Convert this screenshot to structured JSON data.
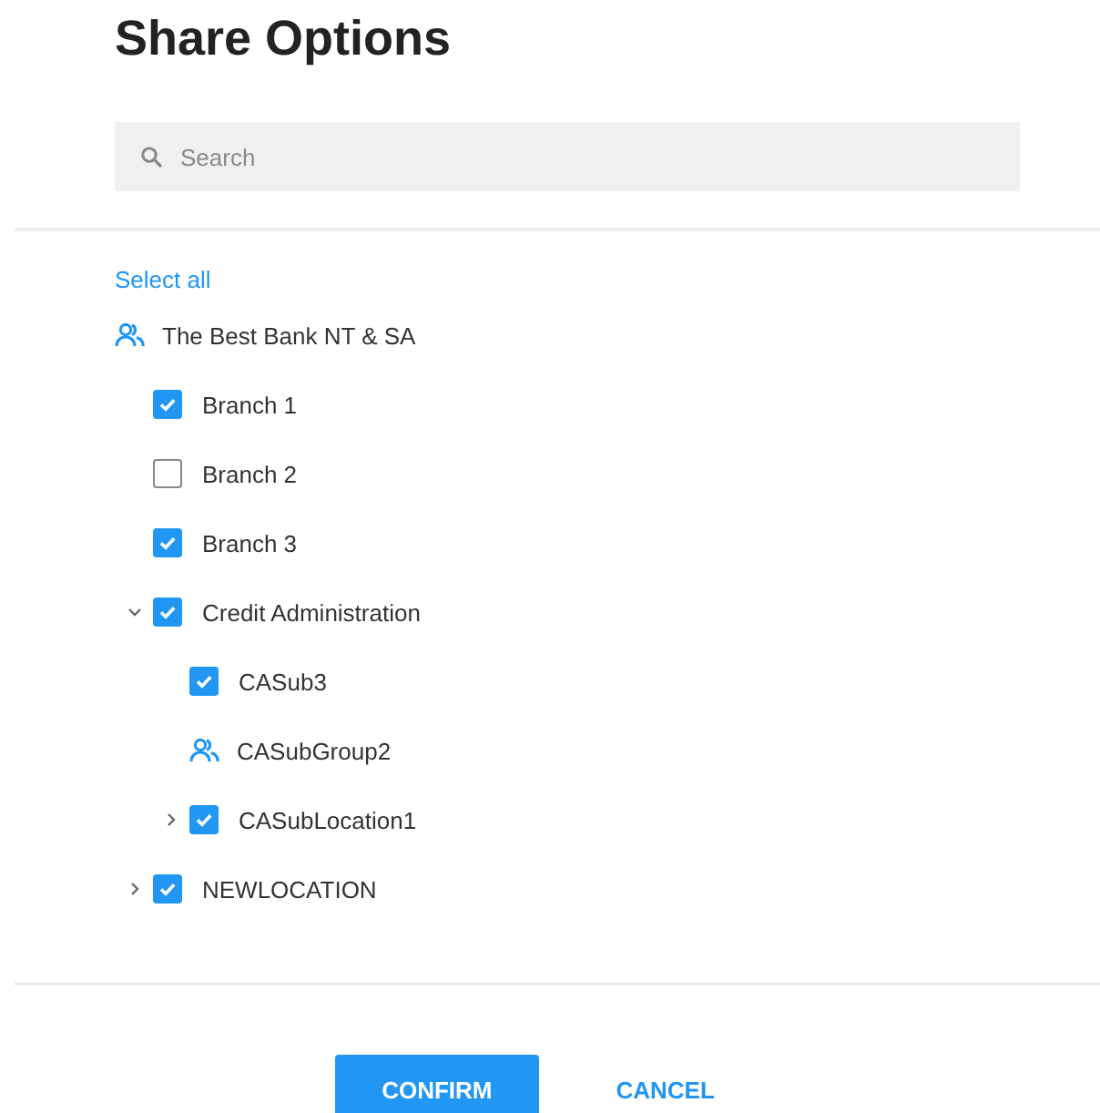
{
  "title": "Share Options",
  "search": {
    "placeholder": "Search"
  },
  "select_all": "Select all",
  "tree": [
    {
      "kind": "group",
      "label": "The Best Bank NT & SA",
      "children": [
        {
          "kind": "checkbox",
          "label": "Branch 1",
          "checked": true
        },
        {
          "kind": "checkbox",
          "label": "Branch 2",
          "checked": false
        },
        {
          "kind": "checkbox",
          "label": "Branch 3",
          "checked": true
        },
        {
          "kind": "checkbox",
          "label": "Credit Administration",
          "checked": true,
          "expanded": true,
          "children": [
            {
              "kind": "checkbox",
              "label": "CASub3",
              "checked": true
            },
            {
              "kind": "group",
              "label": "CASubGroup2"
            },
            {
              "kind": "checkbox",
              "label": "CASubLocation1",
              "checked": true,
              "expanded": false
            }
          ]
        },
        {
          "kind": "checkbox",
          "label": "NEWLOCATION",
          "checked": true,
          "expanded": false
        }
      ]
    }
  ],
  "buttons": [
    {
      "label": "CONFIRM",
      "kind": "primary"
    },
    {
      "label": "CANCEL",
      "kind": "text"
    }
  ]
}
